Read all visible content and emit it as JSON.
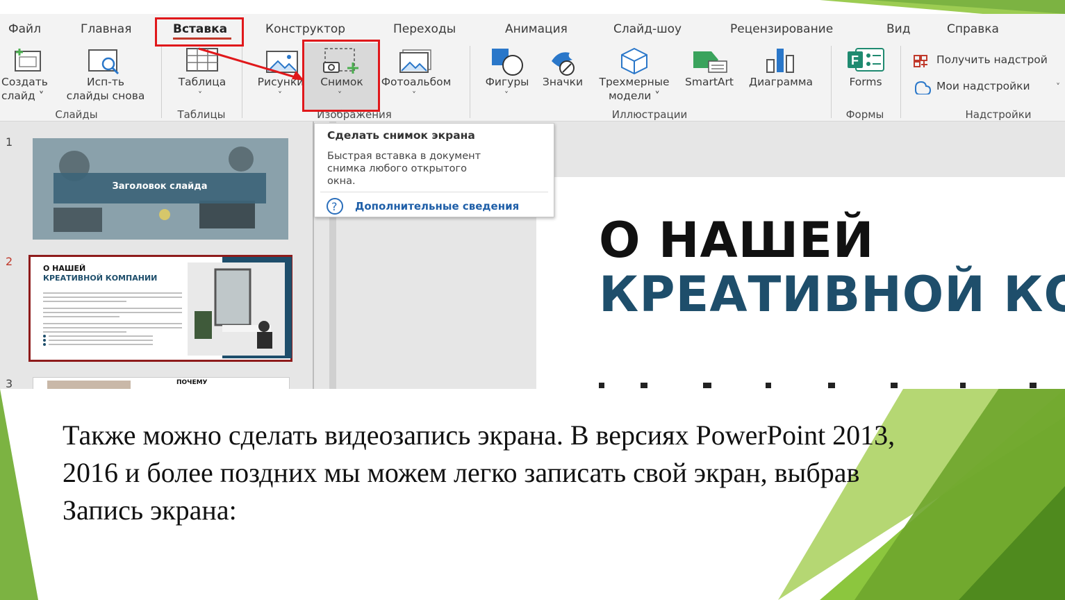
{
  "ribbon_tabs": [
    "Файл",
    "Главная",
    "Вставка",
    "Конструктор",
    "Переходы",
    "Анимация",
    "Слайд-шоу",
    "Рецензирование",
    "Вид",
    "Справка"
  ],
  "active_tab": "Вставка",
  "buttons": {
    "new_slide": [
      "Создать",
      "слайд ˅"
    ],
    "reuse_slides": [
      "Исп-ть",
      "слайды снова"
    ],
    "table": "Таблица",
    "pictures": "Рисунки",
    "screenshot": "Снимок",
    "photo_album": "Фотоальбом",
    "shapes": "Фигуры",
    "icons": "Значки",
    "models_3d": [
      "Трехмерные",
      "модели ˅"
    ],
    "smartart": "SmartArt",
    "chart": "Диаграмма",
    "forms": "Forms",
    "get_addins": "Получить надстрой",
    "my_addins": "Мои надстройки"
  },
  "groups": [
    "Слайды",
    "Таблицы",
    "Изображения",
    "Иллюстрации",
    "Формы",
    "Надстройки"
  ],
  "tooltip": {
    "title": "Сделать снимок экрана",
    "body": [
      "Быстрая вставка в документ",
      "снимка любого открытого",
      "окна."
    ],
    "link": "Дополнительные сведения"
  },
  "thumbnails": {
    "numbers": [
      "1",
      "2",
      "3"
    ],
    "slide1_title": "Заголовок слайда",
    "slide2_title": [
      "О НАШЕЙ",
      "КРЕАТИВНОЙ КОМПАНИИ"
    ],
    "slide3_title": "ПОЧЕМУ"
  },
  "main_slide": {
    "title_line1": "О НАШЕЙ",
    "title_line2": "КРЕАТИВНОЙ КО"
  },
  "caption_lines": [
    "Также можно сделать видеозапись экрана. В версиях PowerPoint 2013,",
    "2016 и более поздних мы можем легко записать свой экран, выбрав",
    "Запись экрана:"
  ],
  "colors": {
    "accent_red": "#e0181b",
    "slide_blue": "#1e4e6b",
    "green_dark": "#6ea52c",
    "green_light": "#a6cf3e"
  }
}
